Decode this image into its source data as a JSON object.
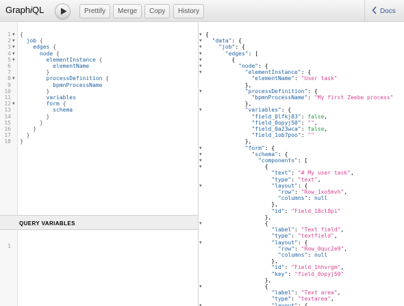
{
  "toolbar": {
    "logo_pre": "Graph",
    "logo_i": "i",
    "logo_post": "QL",
    "prettify": "Prettify",
    "merge": "Merge",
    "copy": "Copy",
    "history": "History",
    "docs": "Docs"
  },
  "query_lines": [
    "{",
    "  job {",
    "    edges {",
    "      node {",
    "        elementInstance {",
    "          elementName",
    "        }",
    "        processDefinition {",
    "          bpmnProcessName",
    "        }",
    "        variables",
    "        form {",
    "          schema",
    "        }",
    "      }",
    "    }",
    "  }",
    "}"
  ],
  "variables_panel": {
    "title": "QUERY VARIABLES",
    "line_number": "1"
  },
  "result_lines": [
    "{",
    "  \"data\": {",
    "    \"job\": {",
    "      \"edges\": [",
    "        {",
    "          \"node\": {",
    "            \"elementInstance\": {",
    "              \"elementName\": \"User task\"",
    "            },",
    "            \"processDefinition\": {",
    "              \"bpmnProcessName\": \"My first Zeebe process\"",
    "            },",
    "            \"variables\": {",
    "              \"field_0lfkj83\": false,",
    "              \"field_0opyj50\": \"\",",
    "              \"field_0a23wca\": false,",
    "              \"field_1ob7poo\": \"\"",
    "            },",
    "            \"form\": {",
    "              \"schema\": {",
    "                \"components\": [",
    "                  {",
    "                    \"text\": \"# My user task\",",
    "                    \"type\": \"text\",",
    "                    \"layout\": {",
    "                      \"row\": \"Row_1xo5mvh\",",
    "                      \"columns\": null",
    "                    },",
    "                    \"id\": \"Field_18cl8pi\"",
    "                  },",
    "                  {",
    "                    \"label\": \"Text field\",",
    "                    \"type\": \"textfield\",",
    "                    \"layout\": {",
    "                      \"row\": \"Row_0quc2e9\",",
    "                      \"columns\": null",
    "                    },",
    "                    \"id\": \"Field_1hhvrgm\",",
    "                    \"key\": \"field_0opyj50\"",
    "                  },",
    "                  {",
    "                    \"label\": \"Text area\",",
    "                    \"type\": \"textarea\",",
    "                    \"layout\": {"
  ],
  "colors": {
    "keyword": "#1f61a0",
    "string": "#d64292",
    "boolean": "#1e9e38",
    "docs_link": "#3b5998"
  }
}
